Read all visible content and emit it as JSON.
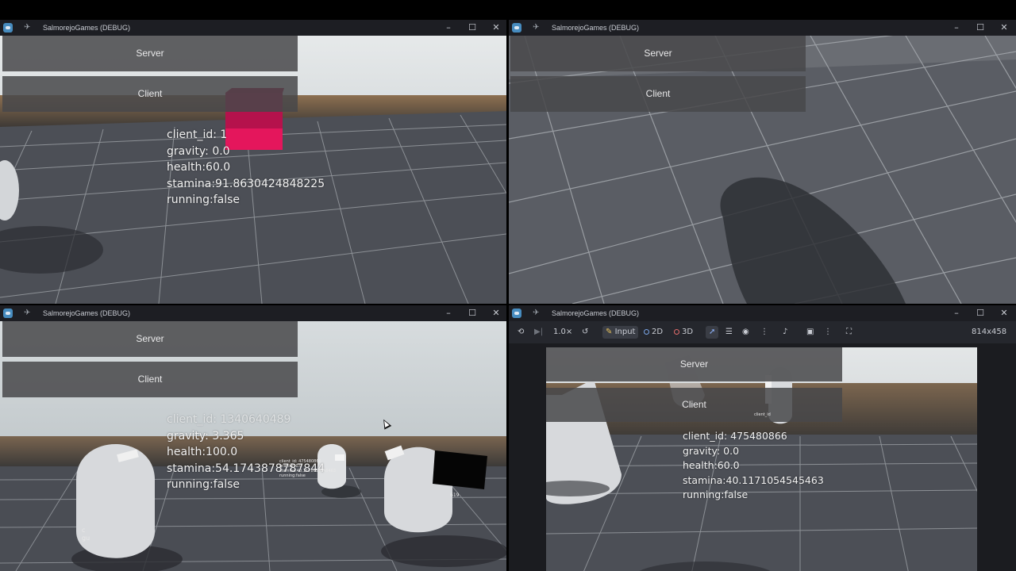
{
  "windows": [
    {
      "title": "SalmorejoGames (DEBUG)",
      "buttons": {
        "server": "Server",
        "client": "Client"
      },
      "stats": [
        "client_id: 1",
        "gravity: 0.0",
        "health:60.0",
        "stamina:91.8630424848225",
        "running:false"
      ]
    },
    {
      "title": "SalmorejoGames (DEBUG)",
      "buttons": {
        "server": "Server",
        "client": "Client"
      }
    },
    {
      "title": "SalmorejoGames (DEBUG)",
      "buttons": {
        "server": "Server",
        "client": "Client"
      },
      "stats": [
        "client_id: 1340640489",
        "gravity: 3.365",
        "health:100.0",
        "stamina:54.1743878787844",
        "running:false"
      ],
      "mini_labels": {
        "player_tag": [
          "client_id: 475480866",
          "gravity: 0.0",
          "stamina:40.1171054545463",
          "running:false"
        ],
        "tag_619": "619",
        "edge_a": "c",
        "edge_b": "gu"
      }
    },
    {
      "title": "SalmorejoGames (DEBUG)",
      "toolbar": {
        "speed": "1.0×",
        "input": "Input",
        "mode_2d": "2D",
        "mode_3d": "3D",
        "resolution": "814x458"
      },
      "buttons": {
        "server": "Server",
        "client": "Client"
      },
      "stats": [
        "client_id: 475480866",
        "gravity: 0.0",
        "health:60.0",
        "stamina:40.1171054545463",
        "running:false"
      ],
      "mini_label": "client_id"
    }
  ],
  "icons": {
    "app": "godot-icon",
    "pin": "pin-icon",
    "minimize": "minimize-icon",
    "maximize": "maximize-icon",
    "close": "close-icon"
  },
  "colors": {
    "sky": "#c4cbcd",
    "floor": "#4b4e55",
    "grid": "#9ea2a8",
    "horizon": "#6e5a45",
    "pink_cube": "#e4165c",
    "button_bg": "#48484a",
    "titlebar": "#1d1e23"
  }
}
